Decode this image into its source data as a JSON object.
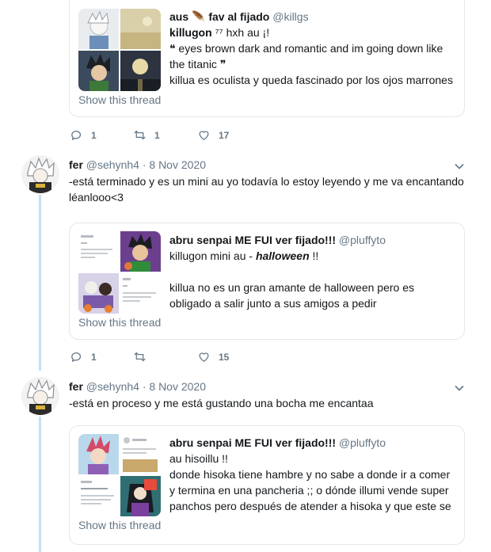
{
  "colors": {
    "accent": "#1da1f2",
    "thread_line": "#bfe0fb",
    "muted": "#657786",
    "border": "#e1e8ed"
  },
  "top_quote": {
    "name": "aus 🪶 fav al fijado",
    "handle": "@killgs",
    "lines": [
      "𝐤𝐢𝐥𝐥𝐮𝐠𝐨𝐧 ⁷⁷ hxh au ¡!",
      "❝ eyes brown dark and romantic and im going down like the titanic ❞",
      "killua es oculista y queda fascinado por los ojos marrones"
    ],
    "show_thread": "Show this thread",
    "thumbs": [
      "killua-art",
      "sand-landscape",
      "gon-art",
      "moon-night"
    ]
  },
  "actions_1": {
    "replies": "1",
    "retweets": "1",
    "likes": "17"
  },
  "tweet_1": {
    "name": "fer",
    "handle": "@sehynh4",
    "date": "· 8 Nov 2020",
    "text": "-está terminado y es un mini au yo todavía lo estoy leyendo y me va encantando léanlooo<3",
    "quote": {
      "name": "abru senpai ME FUI ver fijado!!!",
      "handle": "@pluffyto",
      "line1_prefix": "killugon mini au - ",
      "line1_em": "halloween",
      "line1_suffix": " !!",
      "line2": "killua no es un gran amante de halloween pero es obligado a salir junto a sus amigos a pedir",
      "show_thread": "Show this thread",
      "thumbs": [
        "tweet-screenshot",
        "gon-art",
        "halloween-art",
        "tweet-screenshot-2"
      ]
    }
  },
  "actions_2": {
    "replies": "1",
    "retweets": "",
    "likes": "15"
  },
  "tweet_2": {
    "name": "fer",
    "handle": "@sehynh4",
    "date": "· 8 Nov 2020",
    "text": "-está en proceso y me está gustando una bocha me encantaa",
    "quote": {
      "name": "abru senpai ME FUI ver fijado!!!",
      "handle": "@pluffyto",
      "line1": "au hisoillu !!",
      "line2": "donde hisoka tiene hambre y no sabe a donde ir a comer y termina en una pancheria ;; o dónde illumi vende super panchos pero después de atender a hisoka y que este se",
      "show_thread": "Show this thread",
      "thumbs": [
        "hisoka-art",
        "tweet-screenshot",
        "tweet-screenshot-2",
        "illumi-art"
      ]
    }
  }
}
